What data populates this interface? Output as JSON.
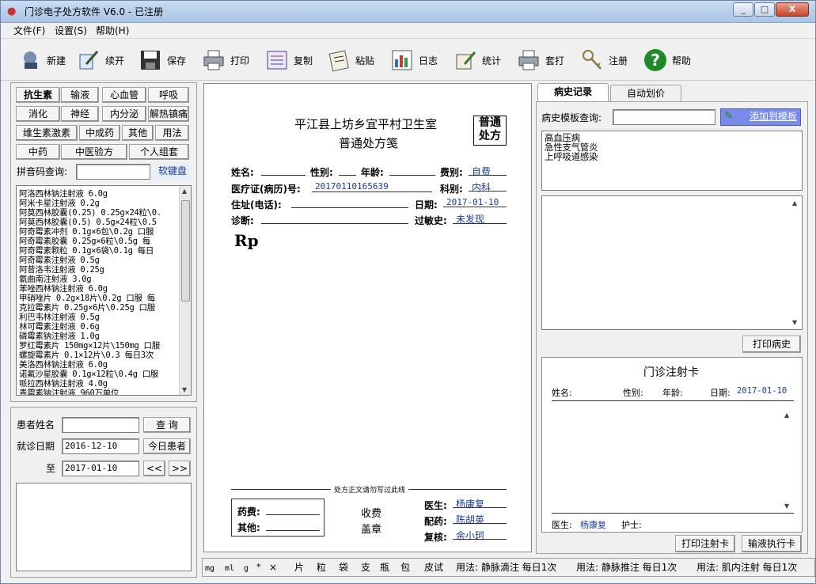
{
  "window": {
    "title": "门诊电子处方软件 V6.0 - 已注册",
    "min": "_",
    "max": "□",
    "close": "X"
  },
  "menu": [
    "文件(F)",
    "设置(S)",
    "帮助(H)"
  ],
  "toolbar": [
    {
      "label": "新建",
      "icon": "new-icon"
    },
    {
      "label": "续开",
      "icon": "continue-icon"
    },
    {
      "label": "保存",
      "icon": "save-icon"
    },
    {
      "label": "打印",
      "icon": "print-icon"
    },
    {
      "label": "复制",
      "icon": "copy-icon"
    },
    {
      "label": "粘贴",
      "icon": "paste-icon"
    },
    {
      "label": "日志",
      "icon": "log-icon"
    },
    {
      "label": "统计",
      "icon": "stats-icon"
    },
    {
      "label": "套打",
      "icon": "template-print-icon"
    },
    {
      "label": "注册",
      "icon": "keys-icon"
    },
    {
      "label": "帮助",
      "icon": "help-icon"
    }
  ],
  "categories": [
    "抗生素",
    "输液",
    "心血管",
    "呼吸",
    "消化",
    "神经",
    "内分泌",
    "解热镇痛",
    "维生素激素",
    "中成药",
    "其他",
    "用法",
    "中药",
    "中医验方",
    "个人组套"
  ],
  "pinyin": {
    "label": "拼音码查询:",
    "value": "",
    "keyboard": "软键盘"
  },
  "drugs": [
    "阿洛西林钠注射液 6.0g",
    "阿米卡星注射液  0.2g",
    "阿莫西林胶囊(0.25)  0.25g×24粒\\0.",
    "阿莫西林胶囊(0.5)  0.5g×24粒\\0.5",
    "阿奇霉素冲剂  0.1g×6包\\0.2g 口服",
    "阿奇霉素胶囊  0.25g×6粒\\0.5g  每",
    "阿奇霉素颗粒  0.1g×6袋\\0.1g  每日",
    "阿奇霉素注射液  0.5g",
    "阿昔洛韦注射液  0.25g",
    "氨曲南注射液 3.0g",
    "苯唑西林钠注射液 6.0g",
    "甲硝唑片  0.2g×18片\\0.2g 口服 每",
    "克拉霉素片  0.25g×6片\\0.25g 口服",
    "利巴韦林注射液  0.5g",
    "林可霉素注射液  0.6g",
    "磷霉素钠注射液  1.0g",
    "罗红霉素片 150mg×12片\\150mg 口服",
    "螺旋霉素片  0.1×12片\\0.3 每日3次",
    "美洛西林钠注射液 6.0g",
    "诺氟沙星胶囊  0.1g×12粒\\0.4g 口服",
    "哌拉西林钠注射液 4.0g",
    "青霉素钠注射液  960万单位"
  ],
  "search": {
    "patient_label": "患者姓名",
    "patient_value": "",
    "query_btn": "查  询",
    "date_label": "就诊日期",
    "date_from": "2016-12-10",
    "today_btn": "今日患者",
    "to_label": "至",
    "date_to": "2017-01-10",
    "prev": "<<",
    "next": ">>"
  },
  "rx": {
    "clinic": "平江县上坊乡宜平村卫生室",
    "form": "普通处方笺",
    "stamp": "普通\n处方",
    "name_label": "姓名:",
    "gender_label": "性别:",
    "age_label": "年龄:",
    "fee_label": "费别:",
    "fee": "自费",
    "card_label": "医疗证(病历)号:",
    "card": "20170110165639",
    "dept_label": "科别:",
    "dept": "内科",
    "addr_label": "住址(电话):",
    "date_label": "日期:",
    "date": "2017-01-10",
    "diag_label": "诊断:",
    "allergy_label": "过敏史:",
    "allergy": "未发现",
    "rp": "Rp",
    "divider": "处方正文请勿写过此线",
    "drug_fee_label": "药费:",
    "other_label": "其他:",
    "charge": "收费",
    "seal": "盖章",
    "doctor_label": "医生:",
    "doctor": "杨康复",
    "dispense_label": "配药:",
    "dispense": "陈胡英",
    "review_label": "复核:",
    "review": "余小珂"
  },
  "right": {
    "tab1": "病史记录",
    "tab2": "自动划价",
    "history_label": "病史模板查询:",
    "history_value": "",
    "add_btn": "添加到模板",
    "history_items": [
      "高血压病",
      "急性支气管炎",
      "上呼吸道感染"
    ],
    "print_history": "打印病史",
    "card_title": "门诊注射卡",
    "c_name": "姓名:",
    "c_gender": "性别:",
    "c_age": "年龄:",
    "c_date_label": "日期:",
    "c_date": "2017-01-10",
    "c_doctor_label": "医生:",
    "c_doctor": "杨康复",
    "c_nurse_label": "护士:",
    "print_card": "打印注射卡",
    "infusion": "输液执行卡"
  },
  "status": [
    "mg",
    "ml",
    "g",
    "*",
    "×",
    "片",
    "粒",
    "袋",
    "支",
    "瓶",
    "包",
    "皮试",
    "用法: 静脉滴注 每日1次",
    "用法: 静脉推注 每日1次",
    "用法: 肌内注射 每日1次"
  ]
}
